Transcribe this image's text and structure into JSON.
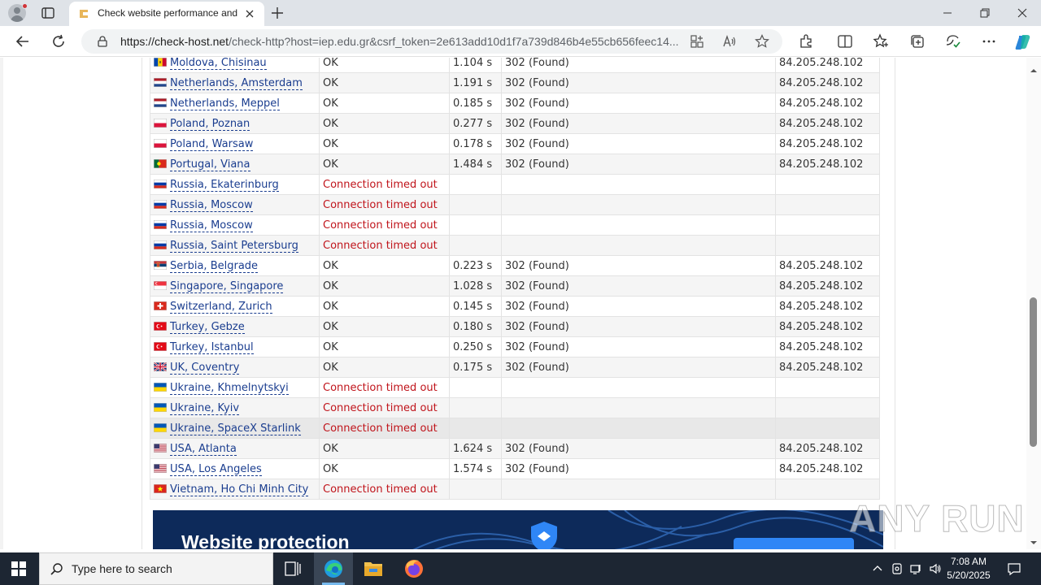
{
  "browser": {
    "tab_title": "Check website performance and",
    "url_host": "https://check-host.net",
    "url_path": "/check-http?host=iep.edu.gr&csrf_token=2e613add10d1f7a739d846b4e55cb656feec14..."
  },
  "results": [
    {
      "location": "Moldova, Chisinau",
      "flag": "md",
      "result": "OK",
      "time": "1.104 s",
      "code": "302 (Found)",
      "ip": "84.205.248.102",
      "error": false
    },
    {
      "location": "Netherlands, Amsterdam",
      "flag": "nl",
      "result": "OK",
      "time": "1.191 s",
      "code": "302 (Found)",
      "ip": "84.205.248.102",
      "error": false
    },
    {
      "location": "Netherlands, Meppel",
      "flag": "nl",
      "result": "OK",
      "time": "0.185 s",
      "code": "302 (Found)",
      "ip": "84.205.248.102",
      "error": false
    },
    {
      "location": "Poland, Poznan",
      "flag": "pl",
      "result": "OK",
      "time": "0.277 s",
      "code": "302 (Found)",
      "ip": "84.205.248.102",
      "error": false
    },
    {
      "location": "Poland, Warsaw",
      "flag": "pl",
      "result": "OK",
      "time": "0.178 s",
      "code": "302 (Found)",
      "ip": "84.205.248.102",
      "error": false
    },
    {
      "location": "Portugal, Viana",
      "flag": "pt",
      "result": "OK",
      "time": "1.484 s",
      "code": "302 (Found)",
      "ip": "84.205.248.102",
      "error": false
    },
    {
      "location": "Russia, Ekaterinburg",
      "flag": "ru",
      "result": "Connection timed out",
      "time": "",
      "code": "",
      "ip": "",
      "error": true
    },
    {
      "location": "Russia, Moscow",
      "flag": "ru",
      "result": "Connection timed out",
      "time": "",
      "code": "",
      "ip": "",
      "error": true
    },
    {
      "location": "Russia, Moscow",
      "flag": "ru",
      "result": "Connection timed out",
      "time": "",
      "code": "",
      "ip": "",
      "error": true
    },
    {
      "location": "Russia, Saint Petersburg",
      "flag": "ru",
      "result": "Connection timed out",
      "time": "",
      "code": "",
      "ip": "",
      "error": true
    },
    {
      "location": "Serbia, Belgrade",
      "flag": "rs",
      "result": "OK",
      "time": "0.223 s",
      "code": "302 (Found)",
      "ip": "84.205.248.102",
      "error": false
    },
    {
      "location": "Singapore, Singapore",
      "flag": "sg",
      "result": "OK",
      "time": "1.028 s",
      "code": "302 (Found)",
      "ip": "84.205.248.102",
      "error": false
    },
    {
      "location": "Switzerland, Zurich",
      "flag": "ch",
      "result": "OK",
      "time": "0.145 s",
      "code": "302 (Found)",
      "ip": "84.205.248.102",
      "error": false
    },
    {
      "location": "Turkey, Gebze",
      "flag": "tr",
      "result": "OK",
      "time": "0.180 s",
      "code": "302 (Found)",
      "ip": "84.205.248.102",
      "error": false
    },
    {
      "location": "Turkey, Istanbul",
      "flag": "tr",
      "result": "OK",
      "time": "0.250 s",
      "code": "302 (Found)",
      "ip": "84.205.248.102",
      "error": false
    },
    {
      "location": "UK, Coventry",
      "flag": "gb",
      "result": "OK",
      "time": "0.175 s",
      "code": "302 (Found)",
      "ip": "84.205.248.102",
      "error": false
    },
    {
      "location": "Ukraine, Khmelnytskyi",
      "flag": "ua",
      "result": "Connection timed out",
      "time": "",
      "code": "",
      "ip": "",
      "error": true
    },
    {
      "location": "Ukraine, Kyiv",
      "flag": "ua",
      "result": "Connection timed out",
      "time": "",
      "code": "",
      "ip": "",
      "error": true
    },
    {
      "location": "Ukraine, SpaceX Starlink",
      "flag": "ua",
      "result": "Connection timed out",
      "time": "",
      "code": "",
      "ip": "",
      "error": true,
      "highlighted": true
    },
    {
      "location": "USA, Atlanta",
      "flag": "us",
      "result": "OK",
      "time": "1.624 s",
      "code": "302 (Found)",
      "ip": "84.205.248.102",
      "error": false
    },
    {
      "location": "USA, Los Angeles",
      "flag": "us",
      "result": "OK",
      "time": "1.574 s",
      "code": "302 (Found)",
      "ip": "84.205.248.102",
      "error": false
    },
    {
      "location": "Vietnam, Ho Chi Minh City",
      "flag": "vn",
      "result": "Connection timed out",
      "time": "",
      "code": "",
      "ip": "",
      "error": true
    }
  ],
  "banner": {
    "title": "Website protection"
  },
  "watermark": "ANY RUN",
  "taskbar": {
    "search_placeholder": "Type here to search",
    "time": "7:08 AM",
    "date": "5/20/2025"
  },
  "colors": {
    "error_text": "#c0141b",
    "link_text": "#1a3d8f",
    "banner_bg": "#0d2a5a",
    "taskbar_bg": "#1d2633"
  }
}
